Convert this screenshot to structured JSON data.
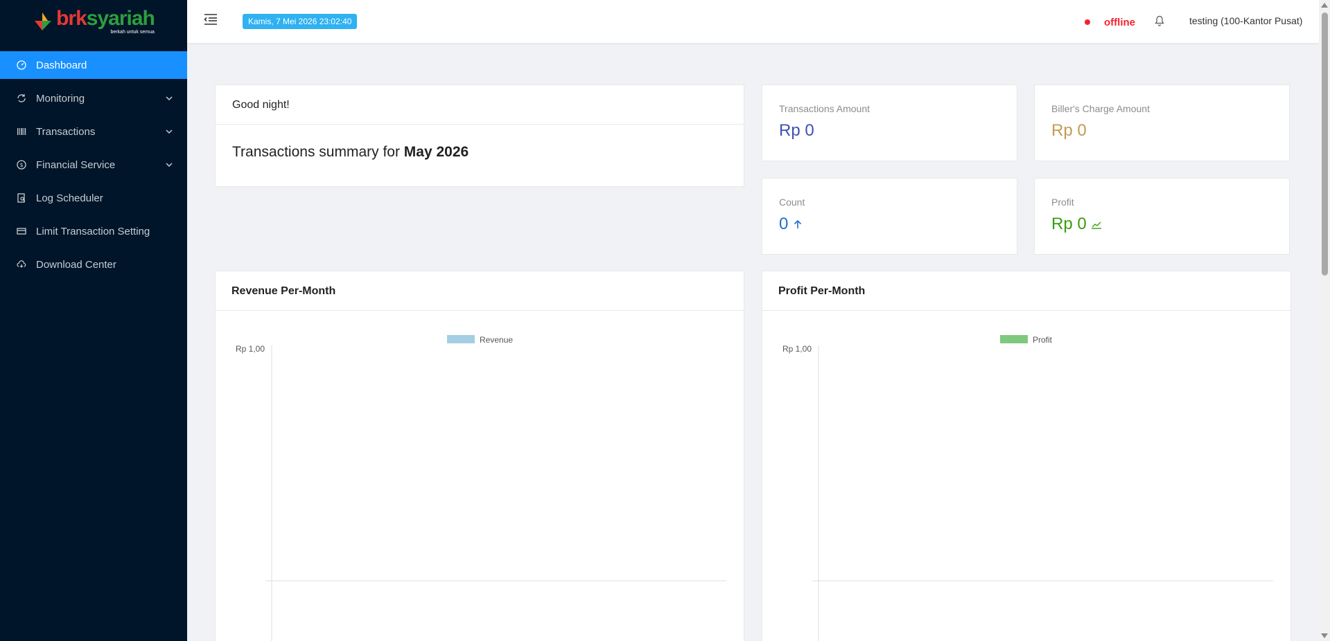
{
  "logo": {
    "brk": "brk",
    "syariah": "syariah",
    "tagline": "berkah untuk semua"
  },
  "sidebar": {
    "items": [
      {
        "label": "Dashboard",
        "icon": "dashboard-icon",
        "active": true,
        "submenu": false
      },
      {
        "label": "Monitoring",
        "icon": "sync-icon",
        "active": false,
        "submenu": true
      },
      {
        "label": "Transactions",
        "icon": "barcode-icon",
        "active": false,
        "submenu": true
      },
      {
        "label": "Financial Service",
        "icon": "dollar-circle-icon",
        "active": false,
        "submenu": true
      },
      {
        "label": "Log Scheduler",
        "icon": "file-search-icon",
        "active": false,
        "submenu": false
      },
      {
        "label": "Limit Transaction Setting",
        "icon": "credit-card-icon",
        "active": false,
        "submenu": false
      },
      {
        "label": "Download Center",
        "icon": "cloud-download-icon",
        "active": false,
        "submenu": false
      }
    ]
  },
  "header": {
    "datetime": "Kamis, 7 Mei 2026 23:02:40",
    "status": "offline",
    "user": "testing (100-Kantor Pusat)"
  },
  "welcome": {
    "greeting": "Good night!",
    "summary_prefix": "Transactions summary for ",
    "summary_period": "May 2026"
  },
  "stats": {
    "transactions_amount": {
      "label": "Transactions Amount",
      "value": "Rp 0",
      "color": "#3f51b5"
    },
    "billers_charge": {
      "label": "Biller's Charge Amount",
      "value": "Rp 0",
      "color": "#c49a55"
    },
    "count": {
      "label": "Count",
      "value": "0",
      "color": "#1e6fd0",
      "icon": "arrow-up-icon"
    },
    "profit": {
      "label": "Profit",
      "value": "Rp 0",
      "color": "#389e0d",
      "icon": "line-chart-icon"
    }
  },
  "colors": {
    "sidebar_bg": "#001529",
    "active": "#1890ff",
    "offline": "#f5222d",
    "revenue": "#a6cee3",
    "profit": "#7fc97f"
  },
  "chart_data": [
    {
      "type": "bar",
      "title": "Revenue Per-Month",
      "series": [
        {
          "name": "Revenue",
          "values": [],
          "color": "#a6cee3"
        }
      ],
      "categories": [],
      "yticks": [
        "Rp 1,00"
      ],
      "ylim": [
        0,
        1
      ],
      "legend": "top-center"
    },
    {
      "type": "bar",
      "title": "Profit Per-Month",
      "series": [
        {
          "name": "Profit",
          "values": [],
          "color": "#7fc97f"
        }
      ],
      "categories": [],
      "yticks": [
        "Rp 1,00"
      ],
      "ylim": [
        0,
        1
      ],
      "legend": "top-center"
    }
  ]
}
